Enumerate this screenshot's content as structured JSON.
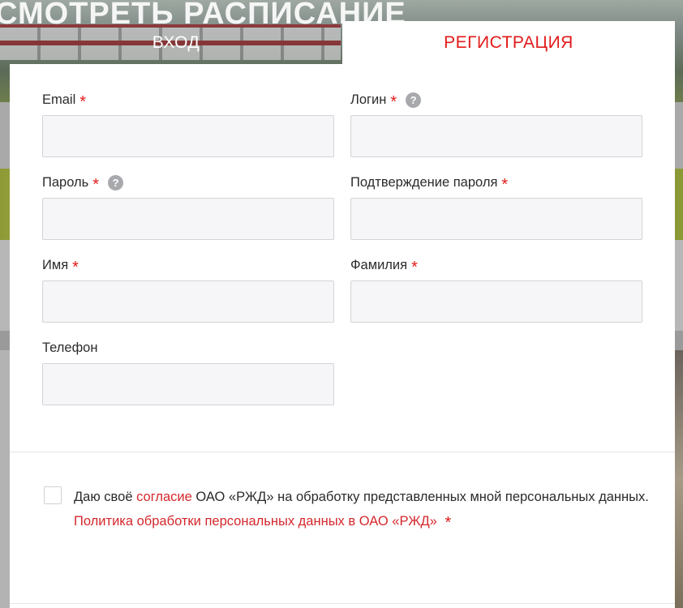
{
  "background": {
    "hero_title": "СМОТРЕТЬ РАСПИСАНИЕ"
  },
  "tabs": {
    "login_label": "ВХОД",
    "register_label": "РЕГИСТРАЦИЯ"
  },
  "form": {
    "email": {
      "label": "Email",
      "value": "",
      "required": true
    },
    "login": {
      "label": "Логин",
      "value": "",
      "required": true,
      "help_icon": "?"
    },
    "password": {
      "label": "Пароль",
      "value": "",
      "required": true,
      "help_icon": "?"
    },
    "password_confirm": {
      "label": "Подтверждение пароля",
      "value": "",
      "required": true
    },
    "first_name": {
      "label": "Имя",
      "value": "",
      "required": true
    },
    "last_name": {
      "label": "Фамилия",
      "value": "",
      "required": true
    },
    "phone": {
      "label": "Телефон",
      "value": "",
      "required": false
    },
    "required_mark": "*"
  },
  "consent": {
    "checked": false,
    "text_before": "Даю своё ",
    "link_consent": "согласие",
    "text_middle": " ОАО «РЖД» на обработку представленных мной персональных данных. ",
    "link_policy": "Политика обработки персональных данных в ОАО «РЖД»",
    "required_mark": "*"
  },
  "colors": {
    "accent": "#e21a1a",
    "input_bg": "#f6f6f8",
    "input_border": "#d3d4d8",
    "help_icon_bg": "#a7a9ac"
  }
}
